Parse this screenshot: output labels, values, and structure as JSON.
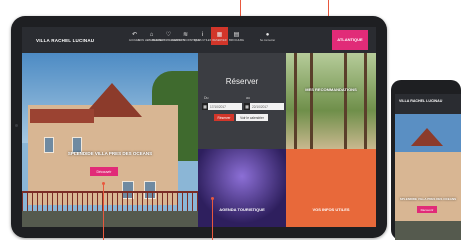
{
  "site": {
    "brand": "VILLA RACHEL LUCINAU",
    "logo_text": "ATLANTIQUE",
    "accent_color": "#d2362a",
    "brand_color": "#e12b78"
  },
  "nav": {
    "items": [
      {
        "label": "ACCUEIL",
        "icon": "back-arrow-icon"
      },
      {
        "label": "MON HEBERGEMENT",
        "icon": "home-icon"
      },
      {
        "label": "MES RECOMMANDATIONS",
        "icon": "heart-icon"
      },
      {
        "label": "AGENDA TOURISTIQUE",
        "icon": "wifi-icon"
      },
      {
        "label": "INFOS UTILES",
        "icon": "info-icon"
      },
      {
        "label": "RESERVER",
        "icon": "calendar-icon",
        "active": true
      },
      {
        "label": "BROCHURE",
        "icon": "document-icon"
      }
    ],
    "account_label": "Se connecter",
    "account_icon": "user-icon"
  },
  "hero": {
    "title": "SPLENDIDE VILLA PRES DES OCEANS",
    "button": "Découvrir"
  },
  "reserve": {
    "title": "Réserver",
    "from_label": "Du",
    "to_label": "au",
    "from_value": "17/10/2017",
    "to_value": "22/10/2017",
    "submit": "Réserver",
    "calendar_link": "Voir le calendrier"
  },
  "tiles": {
    "recommendations": "MES RECOMMANDATIONS",
    "agenda": "AGENDA TOURISTIQUE",
    "infos": "VOS INFOS UTILES"
  },
  "phone": {
    "brand": "VILLA RACHEL LUCINAU",
    "hero_title": "SPLENDIDE VILLA PRES DES OCEANS",
    "button": "Découvrir"
  }
}
